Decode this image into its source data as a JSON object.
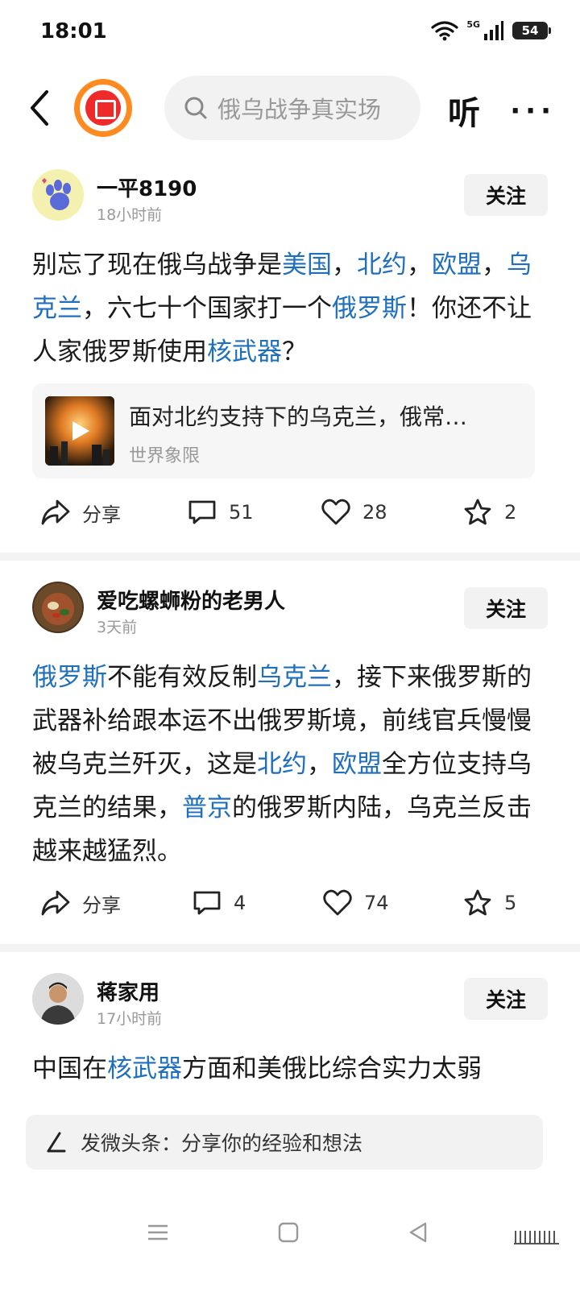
{
  "status": {
    "time": "18:01",
    "network": "5G",
    "battery": "54"
  },
  "header": {
    "search_placeholder": "俄乌战争真实场",
    "listen_label": "听",
    "more_label": "···"
  },
  "posts": [
    {
      "author": "一平8190",
      "time": "18小时前",
      "follow_label": "关注",
      "segments": [
        {
          "t": "别忘了现在俄乌战争是"
        },
        {
          "t": "美国",
          "link": true
        },
        {
          "t": "，"
        },
        {
          "t": "北约",
          "link": true
        },
        {
          "t": "，"
        },
        {
          "t": "欧盟",
          "link": true
        },
        {
          "t": "，"
        },
        {
          "t": "乌克兰",
          "link": true
        },
        {
          "t": "，六七十个国家打一个"
        },
        {
          "t": "俄罗斯",
          "link": true
        },
        {
          "t": "！你还不让人家俄罗斯使用"
        },
        {
          "t": "核武器",
          "link": true
        },
        {
          "t": "？"
        }
      ],
      "card": {
        "title": "面对北约支持下的乌克兰，俄常…",
        "source": "世界象限"
      },
      "actions": {
        "share": "分享",
        "comments": "51",
        "likes": "28",
        "favorites": "2"
      }
    },
    {
      "author": "爱吃螺蛳粉的老男人",
      "time": "3天前",
      "follow_label": "关注",
      "segments": [
        {
          "t": "俄罗斯",
          "link": true
        },
        {
          "t": "不能有效反制"
        },
        {
          "t": "乌克兰",
          "link": true
        },
        {
          "t": "，接下来俄罗斯的武器补给跟本运不出俄罗斯境，前线官兵慢慢被乌克兰歼灭，这是"
        },
        {
          "t": "北约",
          "link": true
        },
        {
          "t": "，"
        },
        {
          "t": "欧盟",
          "link": true
        },
        {
          "t": "全方位支持乌克兰的结果，"
        },
        {
          "t": "普京",
          "link": true
        },
        {
          "t": "的俄罗斯内陆，乌克兰反击越来越猛烈。"
        }
      ],
      "actions": {
        "share": "分享",
        "comments": "4",
        "likes": "74",
        "favorites": "5"
      }
    },
    {
      "author": "蒋家用",
      "time": "17小时前",
      "follow_label": "关注",
      "segments": [
        {
          "t": "中国在"
        },
        {
          "t": "核武器",
          "link": true
        },
        {
          "t": "方面和美俄比综合实力太弱"
        }
      ]
    }
  ],
  "composer": {
    "label": "发微头条：分享你的经验和想法"
  },
  "colors": {
    "link": "#1f6fbf",
    "logo_ring": "#ff8a1f",
    "logo_core": "#ee2a2a"
  }
}
